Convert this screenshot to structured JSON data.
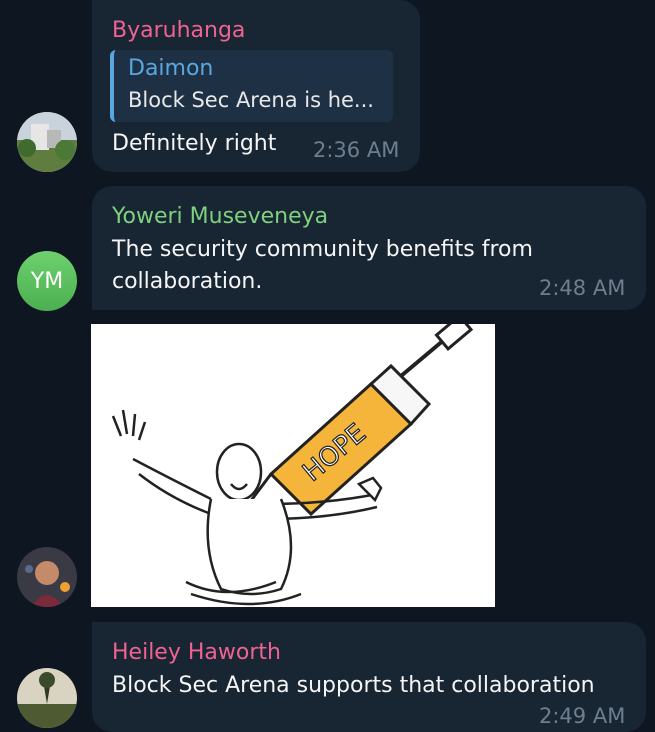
{
  "messages": [
    {
      "sender": "Byaruhanga",
      "sender_color": "#f06292",
      "reply": {
        "name": "Daimon",
        "text": "Block Sec Arena is he..."
      },
      "text": "Definitely right",
      "time": "2:36 AM"
    },
    {
      "sender": "Yoweri Museveneya",
      "sender_color": "#7fd07f",
      "initials": "YM",
      "text_line1": "The security community benefits from",
      "text_line2": "collaboration.",
      "time": "2:48 AM"
    },
    {
      "image_label": "HOPE",
      "image_description": "meme-hope-syringe"
    },
    {
      "sender": "Heiley Haworth",
      "sender_color": "#f06292",
      "text": "Block Sec Arena supports that collaboration",
      "time": "2:49 AM"
    }
  ]
}
